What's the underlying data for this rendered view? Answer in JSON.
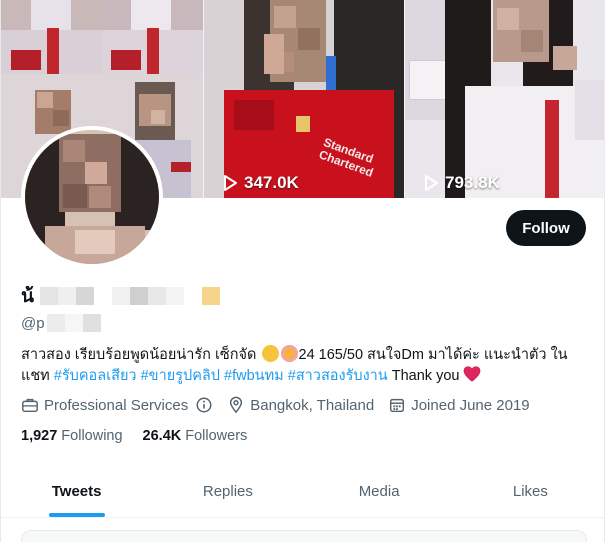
{
  "colors": {
    "accent": "#1d9bf0",
    "text_primary": "#0f1419",
    "text_secondary": "#536471",
    "follow_bg": "#0f1419"
  },
  "banner": {
    "media": [
      {
        "views": ""
      },
      {
        "views": ""
      },
      {
        "views": ""
      },
      {
        "views": "347.0K"
      },
      {
        "views": "793.8K"
      }
    ],
    "jersey_text": "Standard\nChartered"
  },
  "profile": {
    "name": "น้",
    "handle": "@p",
    "follow_label": "Follow",
    "bio_line1": "สาวสอง เรียบร้อยพูดน้อยน่ารัก เซ็กจัด ",
    "bio_line1_tail": "24 165/50  สนใจDm มาได้ค่ะ แนะนำตัว ใน",
    "bio_line2_prefix": "แชท ",
    "hashtags": [
      "#รับคอลเสียว",
      "#ขายรูปคลิป",
      "#fwbนทม",
      "#สาวสองรับงาน"
    ],
    "bio_suffix": " Thank you ",
    "category": "Professional Services",
    "location": "Bangkok, Thailand",
    "joined": "Joined June 2019",
    "following_count": "1,927",
    "following_label": "Following",
    "followers_count": "26.4K",
    "followers_label": "Followers"
  },
  "icons": {
    "category": "briefcase-icon",
    "info": "info-icon",
    "location": "location-pin-icon",
    "calendar": "calendar-icon",
    "play": "play-icon",
    "heart": "red-heart-icon"
  },
  "tabs": [
    {
      "label": "Tweets",
      "active": true
    },
    {
      "label": "Replies",
      "active": false
    },
    {
      "label": "Media",
      "active": false
    },
    {
      "label": "Likes",
      "active": false
    }
  ]
}
